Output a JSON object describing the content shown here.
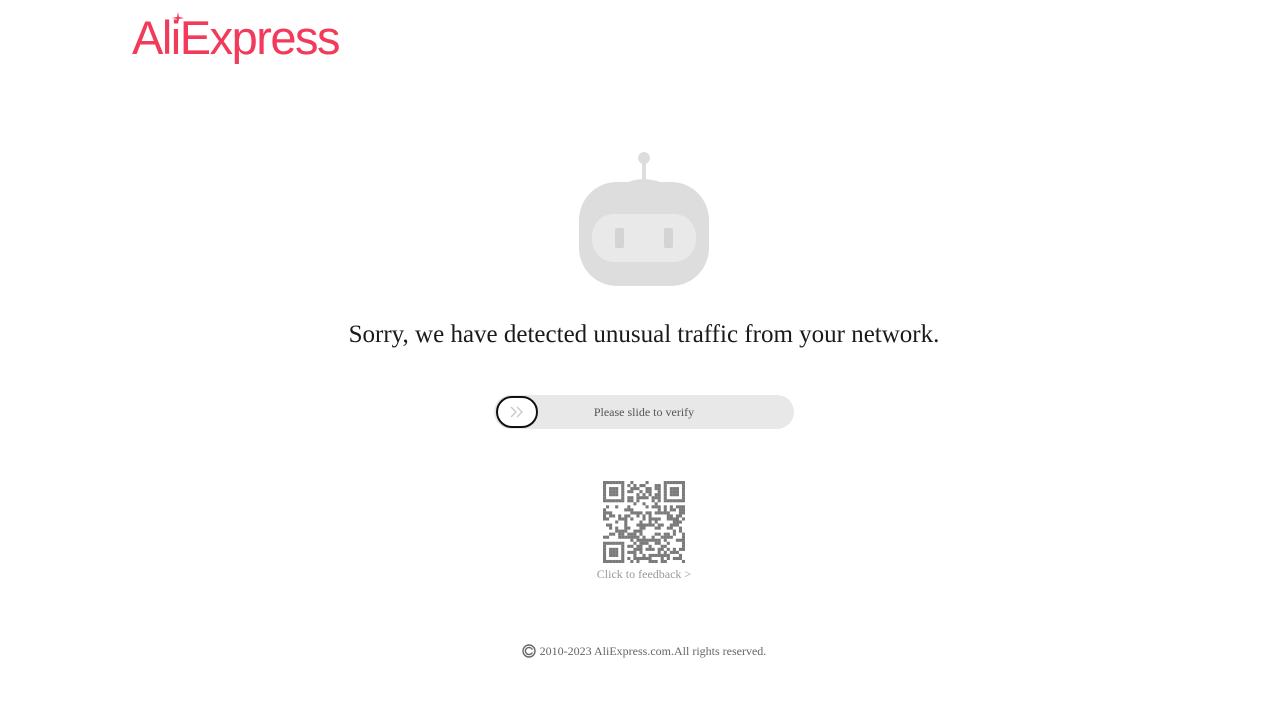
{
  "brand": {
    "logo_text": "AliExpress",
    "color": "#f23a5a"
  },
  "main": {
    "robot_icon": "robot-icon",
    "headline": "Sorry, we have detected unusual traffic from your network."
  },
  "verify": {
    "slider_text": "Please slide to verify",
    "handle_icon": "double-chevron-right-icon",
    "progress": 0
  },
  "feedback": {
    "qr_icon": "qr-code",
    "link_text": "Click to feedback >"
  },
  "footer": {
    "copyright_icon": "copyright-icon",
    "text": "2010-2023 AliExpress.com.All rights reserved."
  }
}
